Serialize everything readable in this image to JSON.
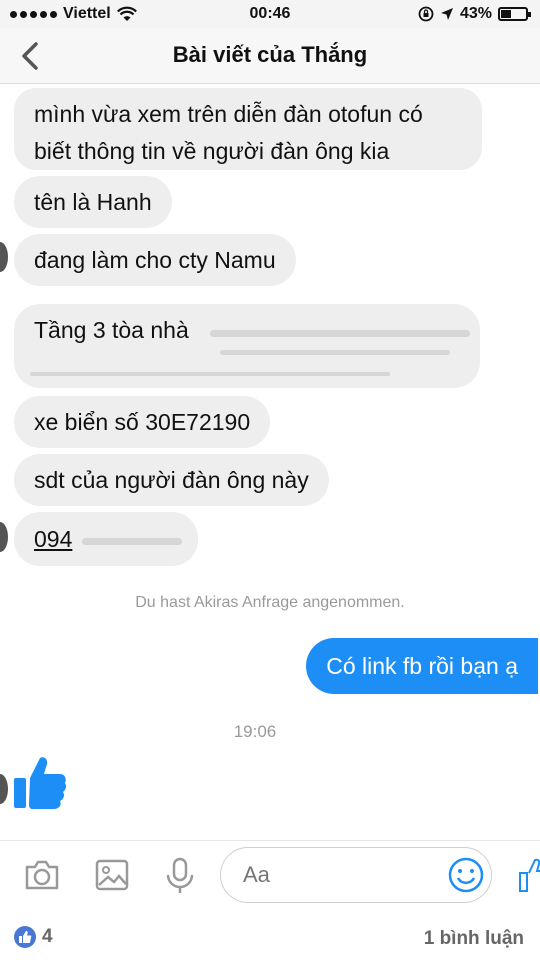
{
  "status_bar": {
    "carrier": "Viettel",
    "time": "00:46",
    "battery": "43%",
    "battery_level": 0.43
  },
  "nav": {
    "title": "Bài viết của Thắng"
  },
  "messages": [
    {
      "line1": "mình vừa xem trên diễn đàn otofun có",
      "line2": "biết thông tin về người đàn ông kia"
    },
    {
      "text": "tên là Hanh"
    },
    {
      "text": "đang làm cho cty Namu"
    },
    {
      "text": "Tầng 3 tòa nhà"
    },
    {
      "text": "xe biển số 30E72190"
    },
    {
      "text": "sdt của người đàn ông này"
    },
    {
      "text": "094"
    }
  ],
  "system_message": "Du hast Akiras Anfrage angenommen.",
  "outgoing": {
    "text": "Có link fb rồi bạn ạ"
  },
  "timestamp": "19:06",
  "composer": {
    "placeholder": "Aa",
    "icons": [
      "camera-icon",
      "image-icon",
      "microphone-icon",
      "smiley-icon",
      "thumbs-up-icon"
    ]
  },
  "footer": {
    "likes": "4",
    "comments": "1 bình luận"
  },
  "colors": {
    "outgoing_bubble": "#1e8ef7",
    "incoming_bubble": "#eeeeee",
    "like_blue": "#1e8ef7"
  }
}
